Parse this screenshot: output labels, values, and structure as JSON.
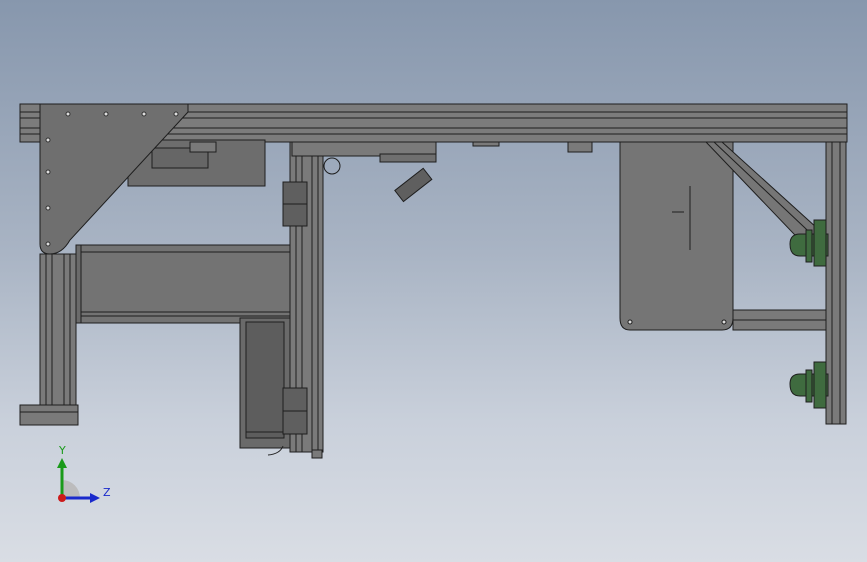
{
  "viewport": {
    "background_top": "#8797ad",
    "background_bottom": "#d9dde4",
    "part_fill": "#7a7a7a",
    "part_edge": "#1e1e1e",
    "bracket_fill": "#6f6f6f",
    "motor_fill": "#3f6b3f"
  },
  "triad": {
    "y_label": "Y",
    "z_label": "Z",
    "y_color": "#1a9a1a",
    "z_color": "#1a2acc",
    "origin_color": "#cc1a1a"
  }
}
